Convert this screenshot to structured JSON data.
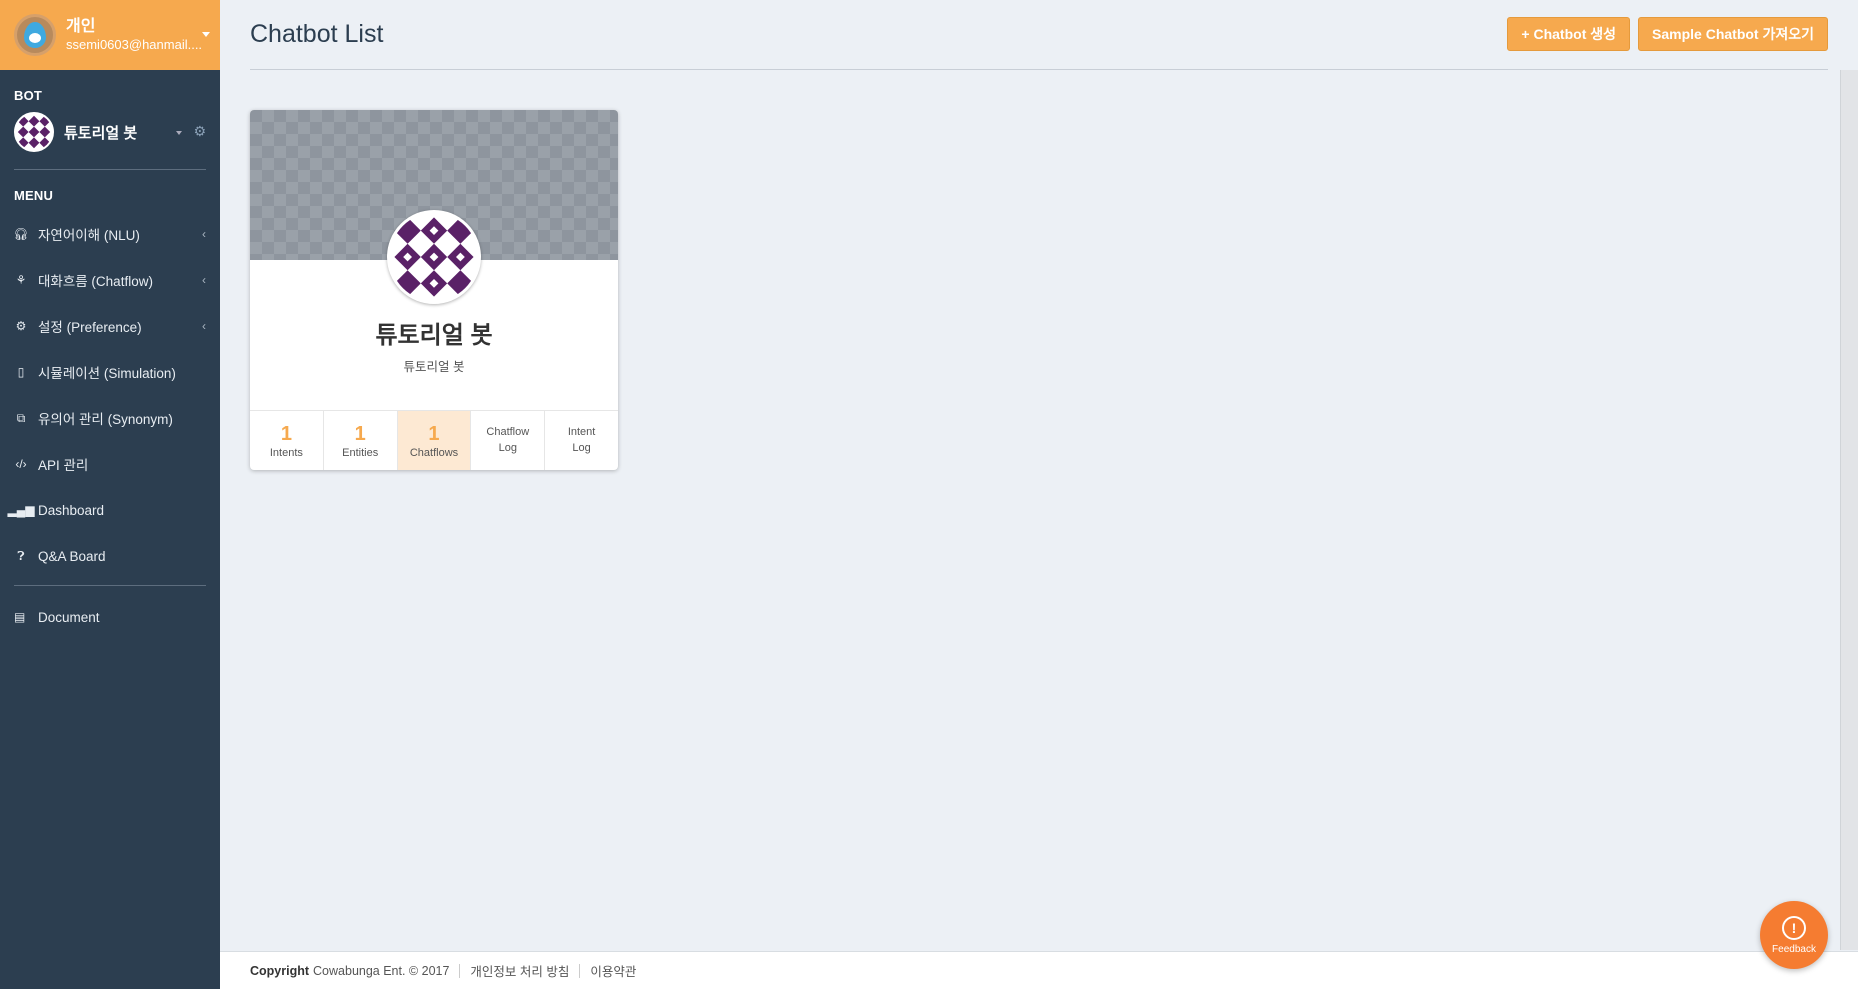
{
  "user": {
    "name": "개인",
    "email": "ssemi0603@hanmail...."
  },
  "bot_section": {
    "label": "BOT",
    "bot_name": "튜토리얼 봇"
  },
  "menu_section": {
    "label": "MENU"
  },
  "menu": [
    {
      "label": "자연어이해 (NLU)",
      "icon": "headset-icon",
      "has_chevron": true
    },
    {
      "label": "대화흐름 (Chatflow)",
      "icon": "flow-icon",
      "has_chevron": true
    },
    {
      "label": "설정 (Preference)",
      "icon": "cogs-icon",
      "has_chevron": true
    },
    {
      "label": "시뮬레이션 (Simulation)",
      "icon": "mobile-icon",
      "has_chevron": false
    },
    {
      "label": "유의어 관리 (Synonym)",
      "icon": "copy-icon",
      "has_chevron": false
    },
    {
      "label": "API 관리",
      "icon": "code-icon",
      "has_chevron": false
    },
    {
      "label": "Dashboard",
      "icon": "bar-chart-icon",
      "has_chevron": false
    },
    {
      "label": "Q&A Board",
      "icon": "question-circle-icon",
      "has_chevron": false
    }
  ],
  "document": {
    "label": "Document",
    "icon": "book-icon"
  },
  "header": {
    "title": "Chatbot List",
    "create_button": "+ Chatbot 생성",
    "sample_button": "Sample Chatbot 가져오기"
  },
  "card": {
    "name": "튜토리얼 봇",
    "description": "튜토리얼 봇",
    "stats": [
      {
        "number": "1",
        "label": "Intents",
        "active": false
      },
      {
        "number": "1",
        "label": "Entities",
        "active": false
      },
      {
        "number": "1",
        "label": "Chatflows",
        "active": true
      }
    ],
    "logs": [
      {
        "line1": "Chatflow",
        "line2": "Log"
      },
      {
        "line1": "Intent",
        "line2": "Log"
      }
    ]
  },
  "footer": {
    "copyright_label": "Copyright",
    "copyright_text": "Cowabunga Ent. © 2017",
    "privacy_link": "개인정보 처리 방침",
    "terms_link": "이용약관"
  },
  "feedback": {
    "label": "Feedback"
  },
  "colors": {
    "accent": "#f6a94e",
    "sidebar": "#2c3e50",
    "bot_purple": "#5a2167",
    "feedback": "#f57c31"
  }
}
